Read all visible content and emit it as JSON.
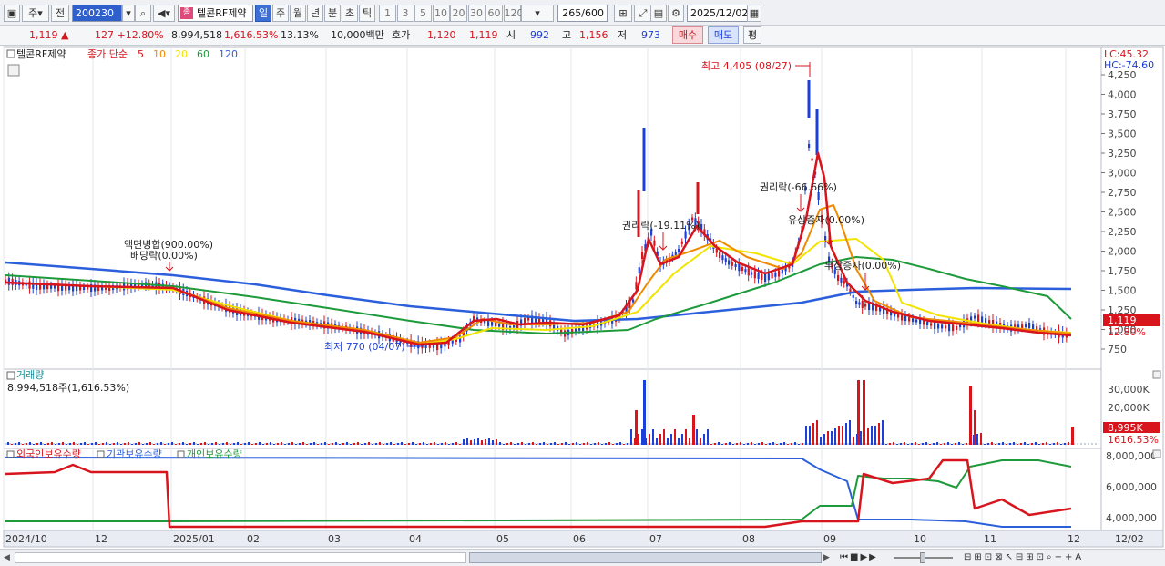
{
  "toolbar": {
    "period_sel": "주",
    "prev_label": "전",
    "code": "200230",
    "stock_name": "텔콘RF제약",
    "stock_icon": "종",
    "periods": [
      "일",
      "주",
      "월",
      "년",
      "분",
      "초",
      "틱"
    ],
    "active_period": "일",
    "intervals": [
      "1",
      "3",
      "5",
      "10",
      "20",
      "30",
      "60",
      "120"
    ],
    "count": "265",
    "count_max": "/600",
    "date": "2025/12/02"
  },
  "quote": {
    "price": "1,119",
    "arrow": "▲",
    "change": "127",
    "change_pct": "+12.80%",
    "volume": "8,994,518",
    "volume_pct": "1,616.53%",
    "turnover": "13.13%",
    "amount": "10,000백만",
    "hoga_label": "호가",
    "ask": "1,120",
    "bid": "1,119",
    "open_label": "시",
    "open": "992",
    "high_label": "고",
    "high": "1,156",
    "low_label": "저",
    "low": "973",
    "buy_label": "매수",
    "sell_label": "매도",
    "eval_label": "평"
  },
  "price_panel": {
    "title": "텔콘RF제약",
    "legend_close": "종가 단순",
    "ma": [
      {
        "label": "5",
        "color": "#d8141c"
      },
      {
        "label": "10",
        "color": "#f08a00"
      },
      {
        "label": "20",
        "color": "#f2e400"
      },
      {
        "label": "60",
        "color": "#1d9a3a"
      },
      {
        "label": "120",
        "color": "#2b5fdc"
      }
    ],
    "lc": "LC:45.32",
    "hc": "HC:-74.60",
    "y_ticks": [
      "4,250",
      "4,000",
      "3,750",
      "3,500",
      "3,250",
      "3,000",
      "2,750",
      "2,500",
      "2,250",
      "2,000",
      "1,750",
      "1,500",
      "1,250",
      "1,000",
      "750"
    ],
    "price_tag": "1,119",
    "pct_tag": "12.80%",
    "ann_max": "최고 4,405 (08/27)",
    "ann_min": "최저 770 (04/07)",
    "ann_split1": "액면병합(900.00%)",
    "ann_split2": "배당락(0.00%)",
    "ann_rights1": "권리락(-19.11%)",
    "ann_rights2": "권리락(-66.66%)",
    "ann_paid": "유상증자(0.00%)",
    "ann_bonus": "무상증자(0.00%)"
  },
  "volume_panel": {
    "title": "거래량",
    "value": "8,994,518주(1,616.53%)",
    "y_ticks": [
      "30,000K",
      "20,000K"
    ],
    "tag1": "8,995K",
    "tag2": "1616.53%"
  },
  "holder_panel": {
    "legend": [
      "외국인보유수량",
      "기관보유수량",
      "개인보유수량"
    ],
    "colors": [
      "#d8141c",
      "#2b5fdc",
      "#1d9a3a"
    ],
    "y_ticks": [
      "8,000,000",
      "6,000,000",
      "4,000,000"
    ]
  },
  "x_axis": {
    "labels": [
      "2024/10",
      "12",
      "2025/01",
      "02",
      "03",
      "04",
      "05",
      "06",
      "07",
      "08",
      "09",
      "10",
      "11",
      "12",
      "12/02"
    ]
  }
}
